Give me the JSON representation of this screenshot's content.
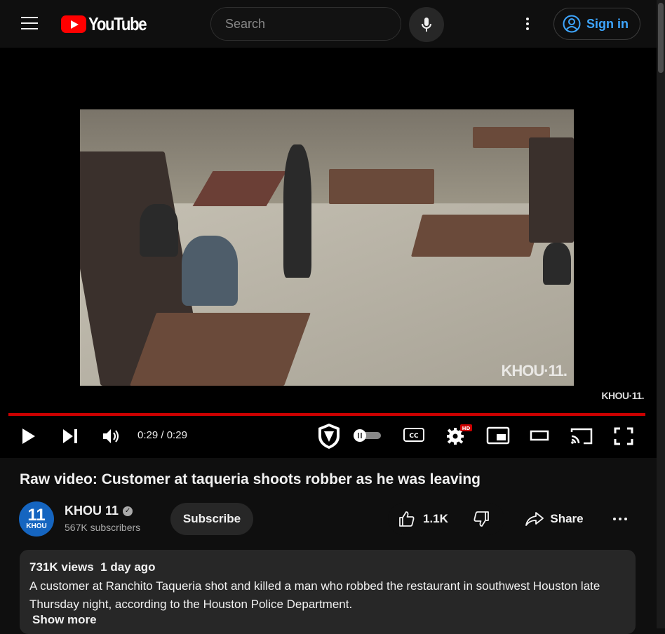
{
  "header": {
    "logo_text": "YouTube",
    "search_placeholder": "Search",
    "signin_label": "Sign in"
  },
  "player": {
    "current_time": "0:29",
    "separator": " / ",
    "duration": "0:29",
    "progress": 1.0,
    "watermark_video": "KHOU·11.",
    "watermark_player": "KHOU·11.",
    "progress_color": "#cc0000"
  },
  "video": {
    "title": "Raw video: Customer at taqueria shoots robber as he was leaving"
  },
  "channel": {
    "avatar_number": "11",
    "avatar_text": "KHOU",
    "name": "KHOU 11",
    "subscribers": "567K subscribers",
    "subscribe_label": "Subscribe"
  },
  "actions": {
    "like_count": "1.1K",
    "share_label": "Share"
  },
  "description": {
    "views": "731K views",
    "date": "1 day ago",
    "text": "A customer at Ranchito Taqueria shot and killed a man who robbed the restaurant in southwest Houston late Thursday night, according to the Houston Police Department.",
    "show_more": "Show more"
  },
  "colors": {
    "background": "#0f0f0f",
    "accent_blue": "#3ea6ff",
    "brand_red": "#ff0000"
  }
}
